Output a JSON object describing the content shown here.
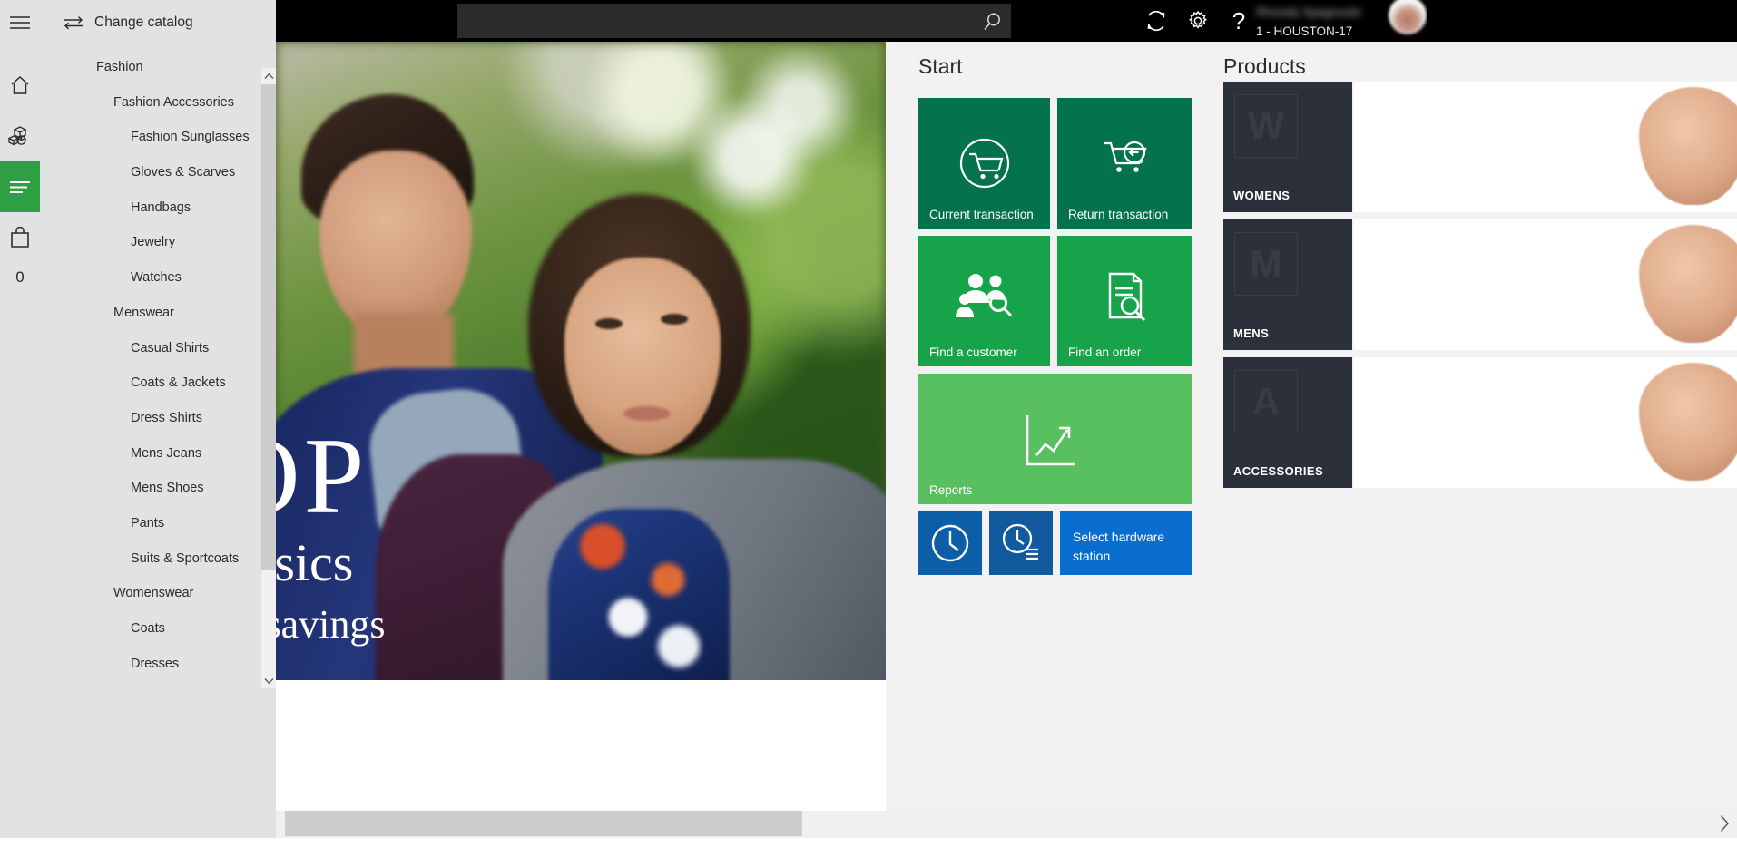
{
  "rail": {
    "items": [
      {
        "name": "hamburger-menu",
        "icon": "hamburger-icon",
        "active": false
      },
      {
        "name": "home",
        "icon": "home-icon",
        "active": false
      },
      {
        "name": "inventory",
        "icon": "boxes-icon",
        "active": false
      },
      {
        "name": "catalog",
        "icon": "list-lines-icon",
        "active": true
      },
      {
        "name": "cart",
        "icon": "shopping-bag-icon",
        "active": false
      }
    ],
    "cart_count": "0"
  },
  "catalog": {
    "change_catalog_label": "Change catalog",
    "change_catalog_icon": "swap-arrows-icon",
    "items": [
      {
        "label": "Fashion",
        "level": 0
      },
      {
        "label": "Fashion Accessories",
        "level": 1
      },
      {
        "label": "Fashion Sunglasses",
        "level": 2
      },
      {
        "label": "Gloves & Scarves",
        "level": 2
      },
      {
        "label": "Handbags",
        "level": 2
      },
      {
        "label": "Jewelry",
        "level": 2
      },
      {
        "label": "Watches",
        "level": 2
      },
      {
        "label": "Menswear",
        "level": 1
      },
      {
        "label": "Casual Shirts",
        "level": 2
      },
      {
        "label": "Coats & Jackets",
        "level": 2
      },
      {
        "label": "Dress Shirts",
        "level": 2
      },
      {
        "label": "Mens Jeans",
        "level": 2
      },
      {
        "label": "Mens Shoes",
        "level": 2
      },
      {
        "label": "Pants",
        "level": 2
      },
      {
        "label": "Suits & Sportcoats",
        "level": 2
      },
      {
        "label": "Womenswear",
        "level": 1
      },
      {
        "label": "Coats",
        "level": 2
      },
      {
        "label": "Dresses",
        "level": 2
      }
    ],
    "scroll_up_icon": "chevron-up-icon",
    "scroll_down_icon": "chevron-down-icon"
  },
  "topbar": {
    "search": {
      "value": "",
      "placeholder": "",
      "icon": "search-icon"
    },
    "refresh_icon": "refresh-icon",
    "settings_icon": "gear-icon",
    "help_icon": "question-mark-icon",
    "user_name": "Rhonda Spagnuolo",
    "store_register": "1 - HOUSTON-17",
    "avatar_icon": "avatar"
  },
  "hero": {
    "line1": "OP",
    "line2": "assics",
    "line3": "e savings"
  },
  "start": {
    "title": "Start",
    "tiles": [
      {
        "id": "tile-current",
        "label": "Current transaction",
        "icon": "cart-circle-icon",
        "color": "#04724d"
      },
      {
        "id": "tile-return",
        "label": "Return transaction",
        "icon": "cart-return-icon",
        "color": "#04724d"
      },
      {
        "id": "tile-customer",
        "label": "Find a customer",
        "icon": "people-search-icon",
        "color": "#16a34a"
      },
      {
        "id": "tile-order",
        "label": "Find an order",
        "icon": "order-search-icon",
        "color": "#16a34a"
      },
      {
        "id": "tile-reports",
        "label": "Reports",
        "icon": "chart-arrow-icon",
        "color": "#59c05f"
      },
      {
        "id": "tile-shift",
        "label": "",
        "icon": "clock-icon",
        "color": "#0d5ea9"
      },
      {
        "id": "tile-shifts",
        "label": "",
        "icon": "clock-list-icon",
        "color": "#125a9e"
      },
      {
        "id": "tile-hardware",
        "label": "Select hardware station",
        "icon": "",
        "color": "#0a6ed1"
      }
    ]
  },
  "products": {
    "title": "Products",
    "cards": [
      {
        "initial": "W",
        "caption": "WOMENS"
      },
      {
        "initial": "M",
        "caption": "MENS"
      },
      {
        "initial": "A",
        "caption": "ACCESSORIES"
      }
    ]
  },
  "bottom": {
    "next_icon": "chevron-right-icon"
  },
  "colors": {
    "accent_green": "#2ea043",
    "tile_dark_green": "#04724d",
    "tile_green": "#16a34a",
    "tile_light_green": "#59c05f",
    "tile_blue": "#0a6ed1",
    "panel_bg": "#f2f2f2",
    "sidebar_bg": "#e1e2e4",
    "topbar_bg": "#000000"
  }
}
